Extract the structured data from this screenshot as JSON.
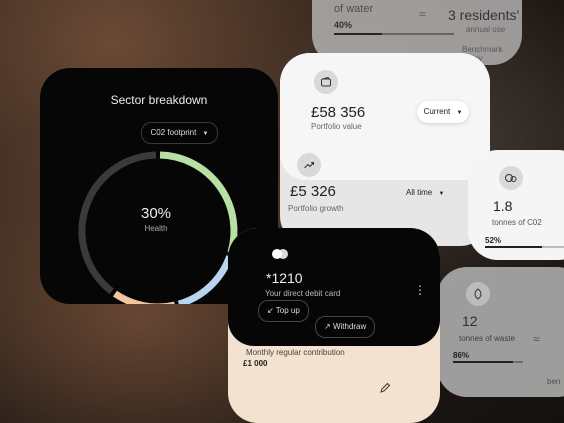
{
  "water_card": {
    "title": "of water",
    "approx_symbol": "≈",
    "value": "3 residents'",
    "sub": "annual use",
    "percent": "40%",
    "percent_value": 0.4,
    "link": "Benchmark policy"
  },
  "sector": {
    "title": "Sector breakdown",
    "dropdown_label": "C02 footprint",
    "center_value": "30%",
    "center_label": "Health",
    "segments": [
      {
        "name": "green",
        "fraction": 0.3,
        "color": "#b8e0a3"
      },
      {
        "name": "blue",
        "fraction": 0.16,
        "color": "#b8d6ef"
      },
      {
        "name": "orange",
        "fraction": 0.14,
        "color": "#f0c69e"
      },
      {
        "name": "grey",
        "fraction": 0.4,
        "color": "#3a3a3a"
      }
    ]
  },
  "portfolio": {
    "value": "£58 356",
    "value_label": "Portfolio value",
    "period": "Current",
    "growth": "£5 326",
    "growth_label": "Portfolio growth",
    "growth_period": "All time"
  },
  "co2_card": {
    "value": "1.8",
    "label": "tonnes of C02",
    "percent": "52%",
    "percent_value": 0.52
  },
  "waste_card": {
    "value": "12",
    "label": "tonnes of waste",
    "approx_symbol": "≈",
    "percent": "86%",
    "percent_value": 0.86,
    "extra": "ben"
  },
  "debit": {
    "amount": "*1210",
    "description": "Your direct debit card",
    "top_up": "Top up",
    "withdraw": "Withdraw",
    "contribution_label": "Monthly regular contribution",
    "contribution_amount": "£1 000"
  }
}
